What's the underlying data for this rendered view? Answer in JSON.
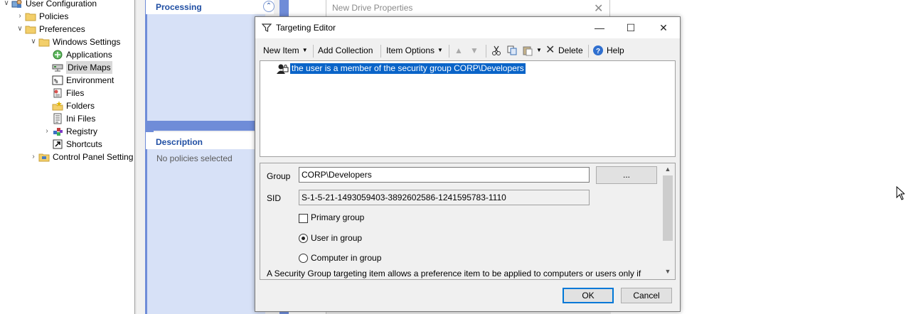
{
  "tree": {
    "items": [
      {
        "label": "User Configuration",
        "icon": "user-config-icon",
        "expanded": true
      },
      {
        "label": "Policies",
        "icon": "folder-icon",
        "expanded": false
      },
      {
        "label": "Preferences",
        "icon": "folder-icon",
        "expanded": true
      },
      {
        "label": "Windows Settings",
        "icon": "folder-icon",
        "expanded": true
      },
      {
        "label": "Applications",
        "icon": "applications-icon"
      },
      {
        "label": "Drive Maps",
        "icon": "drive-maps-icon",
        "selected": true
      },
      {
        "label": "Environment",
        "icon": "environment-icon"
      },
      {
        "label": "Files",
        "icon": "files-icon"
      },
      {
        "label": "Folders",
        "icon": "folders-icon"
      },
      {
        "label": "Ini Files",
        "icon": "ini-files-icon"
      },
      {
        "label": "Registry",
        "icon": "registry-icon",
        "expanded": false
      },
      {
        "label": "Shortcuts",
        "icon": "shortcuts-icon"
      },
      {
        "label": "Control Panel Setting",
        "icon": "control-panel-icon",
        "expanded": false
      }
    ]
  },
  "middle_panel": {
    "processing_header": "Processing",
    "description_header": "Description",
    "description_text": "No policies selected"
  },
  "background_window": {
    "title": "New Drive Properties"
  },
  "dialog": {
    "title": "Targeting Editor",
    "toolbar": {
      "new_item": "New Item",
      "add_collection": "Add Collection",
      "item_options": "Item Options",
      "delete": "Delete",
      "help": "Help"
    },
    "items": [
      {
        "text": "the user is a member of the security group CORP\\Developers",
        "selected": true
      }
    ],
    "properties": {
      "group_label": "Group",
      "group_value": "CORP\\Developers",
      "browse_label": "...",
      "sid_label": "SID",
      "sid_value": "S-1-5-21-1493059403-3892602586-1241595783-1110",
      "primary_group_label": "Primary group",
      "primary_group_checked": false,
      "user_in_group_label": "User in group",
      "computer_in_group_label": "Computer in group",
      "selected_option": "User in group",
      "help_text": "A Security Group targeting item allows a preference item to be applied to computers or users only if"
    },
    "ok_label": "OK",
    "cancel_label": "Cancel"
  },
  "colors": {
    "accent_blue": "#6f8cd8",
    "panel_blue": "#d7e1f7",
    "header_text": "#1f4ea3",
    "selection": "#0a64c8"
  }
}
